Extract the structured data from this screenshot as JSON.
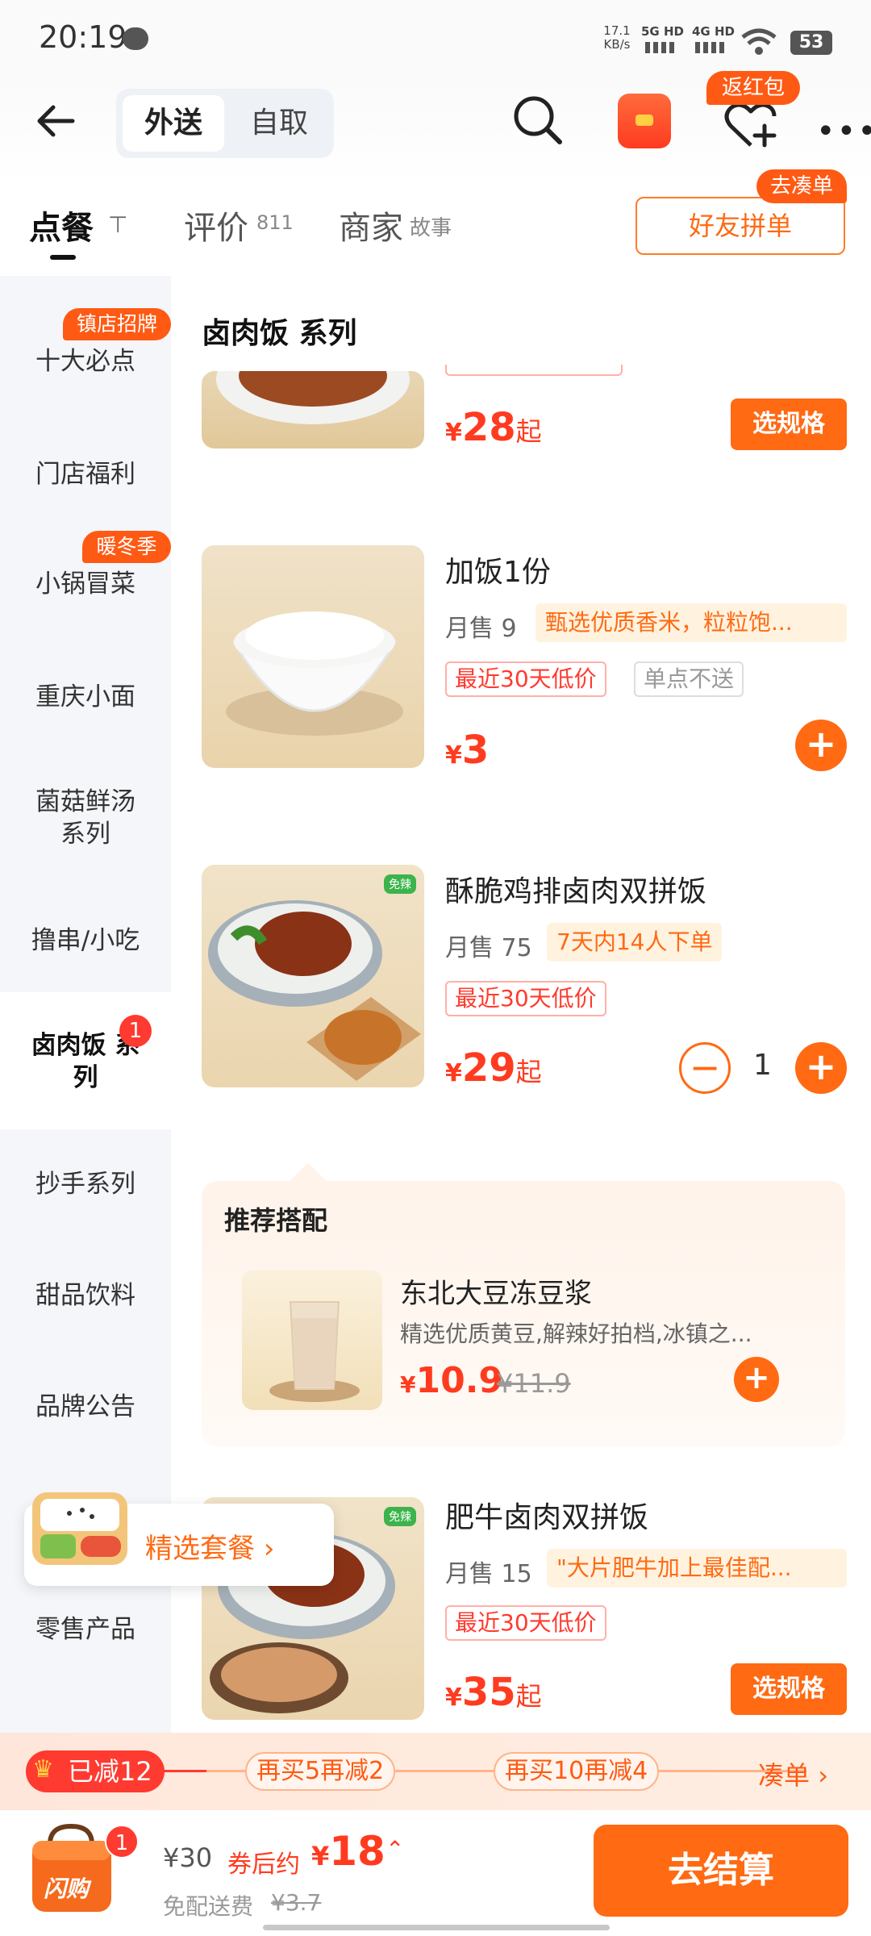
{
  "status_bar": {
    "time": "20:19",
    "speed": "17.1",
    "speed_unit": "KB/s",
    "sig1": "5G HD",
    "sig2": "4G HD",
    "battery": "53"
  },
  "header": {
    "mode_delivery": "外送",
    "mode_pickup": "自取",
    "red_packet_badge": "返红包"
  },
  "tabs": {
    "order": "点餐",
    "reviews": "评价",
    "reviews_count": "811",
    "merchant": "商家",
    "merchant_sub": "故事",
    "group_order": "好友拼单",
    "group_badge": "去凑单"
  },
  "sidebar": {
    "items": [
      {
        "label": "十大必点",
        "badge": "镇店招牌"
      },
      {
        "label": "门店福利"
      },
      {
        "label": "小锅冒菜",
        "badge": "暖冬季"
      },
      {
        "label": "重庆小面"
      },
      {
        "label": "菌菇鲜汤\n系列"
      },
      {
        "label": "撸串/小吃"
      },
      {
        "label": "卤肉饭 系\n列",
        "count": "1"
      },
      {
        "label": "抄手系列"
      },
      {
        "label": "甜品饮料"
      },
      {
        "label": "品牌公告"
      },
      {
        "label": "零售产品"
      }
    ]
  },
  "section_title": "卤肉饭 系列",
  "items": [
    {
      "price_symbol": "¥",
      "price": "28",
      "suffix": "起",
      "action": "选规格"
    },
    {
      "name": "加饭1份",
      "sales": "月售 9",
      "tag": "甄选优质香米，粒粒饱...",
      "tag_low": "最近30天低价",
      "tag_gray": "单点不送",
      "price_symbol": "¥",
      "price": "3"
    },
    {
      "name": "酥脆鸡排卤肉双拼饭",
      "sales": "月售 75",
      "tag": "7天内14人下单",
      "tag_low": "最近30天低价",
      "price_symbol": "¥",
      "price": "29",
      "suffix": "起",
      "qty": "1",
      "thumb_badge": "免辣"
    },
    {
      "name": "肥牛卤肉双拼饭",
      "sales": "月售 15",
      "tag": "\"大片肥牛加上最佳配...",
      "tag_low": "最近30天低价",
      "price_symbol": "¥",
      "price": "35",
      "suffix": "起",
      "action": "选规格",
      "thumb_badge": "免辣"
    }
  ],
  "recommend": {
    "title": "推荐搭配",
    "name": "东北大豆冻豆浆",
    "desc": "精选优质黄豆,解辣好拍档,冰镇之...",
    "price_symbol": "¥",
    "price": "10.9",
    "old_price": "¥11.9"
  },
  "float_set": {
    "label": "精选套餐"
  },
  "discount": {
    "current": "已减12",
    "step2": "再买5再减2",
    "step3": "再买10再减4",
    "go": "凑单"
  },
  "checkout": {
    "bag_count": "1",
    "bag_label": "闪购",
    "original": "¥30",
    "after_label": "券后约",
    "after_symbol": "¥",
    "after_price": "18",
    "free_delivery": "免配送费",
    "delivery_old": "¥3.7",
    "pay": "去结算"
  },
  "colors": {
    "accent": "#ff6a13",
    "price_red": "#ff3b1f",
    "sidebar_bg": "#f4f6fa"
  }
}
